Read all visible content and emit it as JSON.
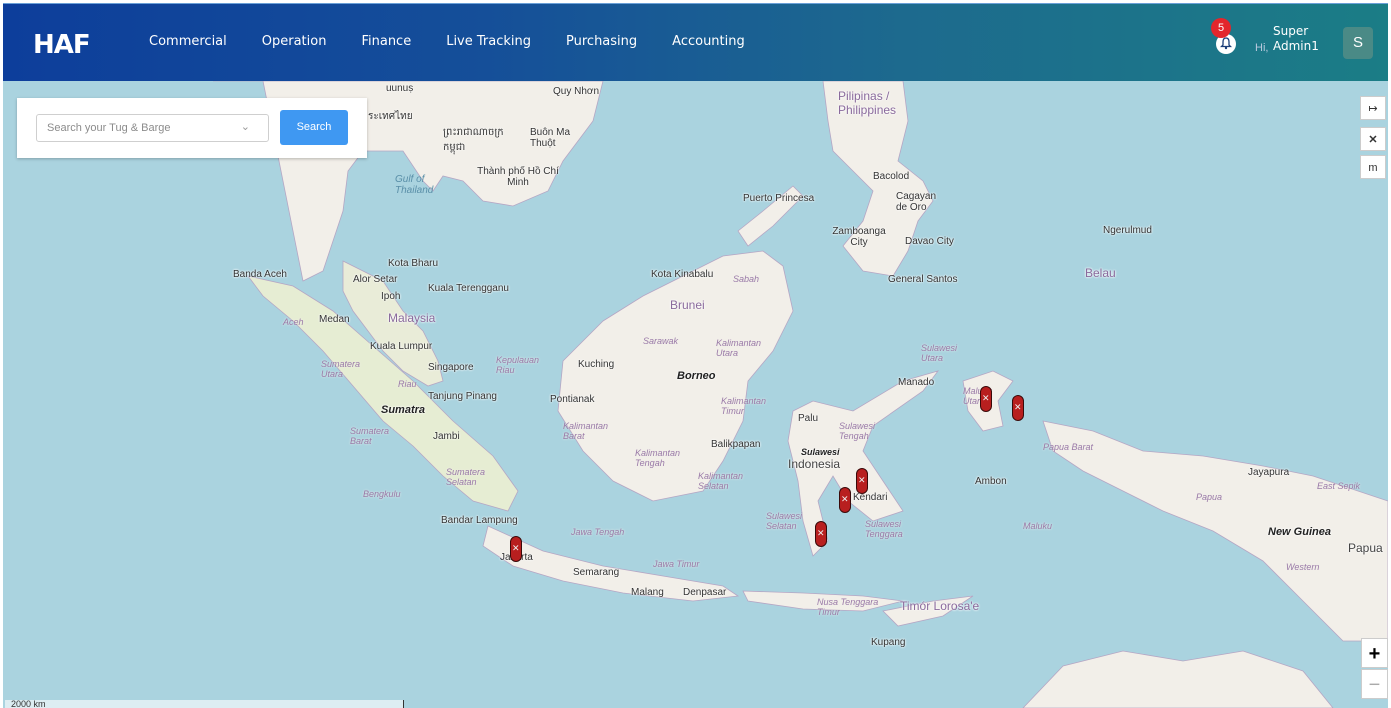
{
  "header": {
    "logo": "HAF",
    "nav": [
      "Commercial",
      "Operation",
      "Finance",
      "Live Tracking",
      "Purchasing",
      "Accounting"
    ],
    "notification_count": "5",
    "greeting": "Hi,",
    "user_line1": "Super",
    "user_line2": "Admin1",
    "avatar_initial": "S"
  },
  "search": {
    "placeholder": "Search your Tug & Barge",
    "button": "Search"
  },
  "controls": {
    "expand": "↦",
    "close": "✕",
    "unit": "m",
    "zoom_in": "+",
    "zoom_out": "−"
  },
  "scale": "2000 km",
  "places": {
    "quy_nhon": "Quy Nhơn",
    "uuno": "uunuṣ",
    "thailand_top": "ระเทศไทย",
    "cambodia": "ព្រះរាជាណាចក្រ កម្ពុជា",
    "buon_ma": "Buôn Ma Thuột",
    "hcm": "Thành phố Hồ Chí Minh",
    "gulf": "Gulf of Thailand",
    "philippines": "Pilipinas / Philippines",
    "puerto_princesa": "Puerto Princesa",
    "bacolod": "Bacolod",
    "cagayan": "Cagayan de Oro",
    "zamboanga": "Zamboanga City",
    "davao": "Davao City",
    "ngerulmud": "Ngerulmud",
    "belau": "Belau",
    "general_santos": "General Santos",
    "kota_bharu": "Kota Bharu",
    "banda_aceh": "Banda Aceh",
    "alor_setar": "Alor Setar",
    "kuala_terengganu": "Kuala Terengganu",
    "ipoh": "Ipoh",
    "malaysia": "Malaysia",
    "kota_kinabalu": "Kota Kinabalu",
    "sabah": "Sabah",
    "brunei": "Brunei",
    "aceh": "Aceh",
    "medan": "Medan",
    "kuala_lumpur": "Kuala Lumpur",
    "sumatera_utara": "Sumatera Utara",
    "singapore": "Singapore",
    "kepulauan_riau": "Kepulauan Riau",
    "kuching": "Kuching",
    "sarawak": "Sarawak",
    "kalimantan_utara": "Kalimantan Utara",
    "borneo": "Borneo",
    "riau": "Riau",
    "tanjung_pinang": "Tanjung Pinang",
    "pontianak": "Pontianak",
    "sumatra": "Sumatra",
    "kalimantan_timur": "Kalimantan Timur",
    "palu": "Palu",
    "sulawesi_utara": "Sulawesi Utara",
    "manado": "Manado",
    "maluku_utara": "Maluku Utara",
    "sumatera_barat": "Sumatera Barat",
    "jambi": "Jambi",
    "kalimantan_barat": "Kalimantan Barat",
    "balikpapan": "Balikpapan",
    "sulawesi_tengah": "Sulawesi Tengah",
    "papua_barat": "Papua Barat",
    "kalimantan_tengah": "Kalimantan Tengah",
    "kalimantan_selatan": "Kalimantan Selatan",
    "sulawesi": "Sulawesi",
    "indonesia": "Indonesia",
    "sumatera_selatan": "Sumatera Selatan",
    "bengkulu": "Bengkulu",
    "kendari": "Kendari",
    "ambon": "Ambon",
    "jayapura": "Jayapura",
    "east_sepik": "East Sepik",
    "papua": "Papua",
    "bandar_lampung": "Bandar Lampung",
    "sulawesi_selatan": "Sulawesi Selatan",
    "sulawesi_tenggara": "Sulawesi Tenggara",
    "maluku": "Maluku",
    "new_guinea": "New Guinea",
    "papua_png": "Papua",
    "jawa_tengah": "Jawa Tengah",
    "jakarta": "Jakarta",
    "western": "Western",
    "jawa_timur": "Jawa Timur",
    "semarang": "Semarang",
    "malang": "Malang",
    "denpasar": "Denpasar",
    "ntt": "Nusa Tenggara Timur",
    "timor": "Timór Lorosa'e",
    "kupang": "Kupang"
  },
  "colors": {
    "sea": "#aad3df",
    "land": "#f2efe9",
    "forest": "#cde5b8",
    "marker": "#b81f1f",
    "header_start": "#0d3e9b",
    "header_end": "#1b7d86",
    "search_button": "#3f98f2",
    "badge": "#e3262c"
  }
}
